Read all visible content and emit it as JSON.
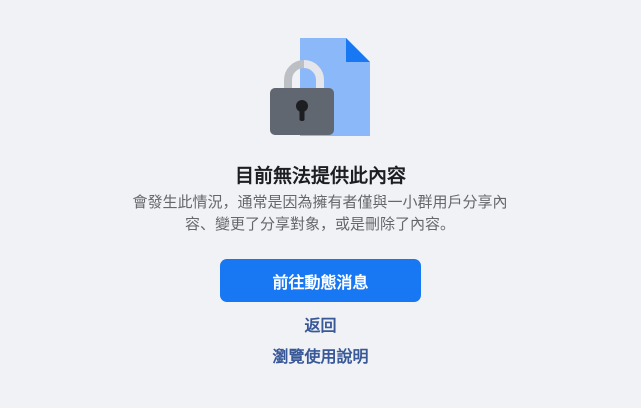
{
  "illustration": {
    "icon": "lock-on-document-icon",
    "colors": {
      "document": "#8ab8f8",
      "document_fold": "#1877f2",
      "shackle": "#bcc0c4",
      "lock_body": "#606770",
      "keyhole": "#1c1e21"
    }
  },
  "content": {
    "title": "目前無法提供此內容",
    "message_line1": "會發生此情況，通常是因為擁有者僅與一小群用戶分享內",
    "message_line2": "容、變更了分享對象，或是刪除了內容。"
  },
  "actions": {
    "primary_label": "前往動態消息",
    "back_label": "返回",
    "help_label": "瀏覽使用說明"
  },
  "colors": {
    "background": "#f0f2f5",
    "primary": "#1877f2",
    "link": "#385898"
  }
}
